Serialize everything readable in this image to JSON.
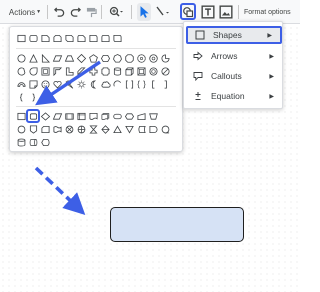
{
  "toolbar": {
    "actions_label": "Actions",
    "format_options_label": "Format options",
    "icons": [
      "undo-icon",
      "redo-icon",
      "paint-format-icon",
      "zoom-icon",
      "select-pointer-icon",
      "line-icon",
      "shape-icon",
      "text-box-icon",
      "image-icon"
    ]
  },
  "insert_menu": {
    "items": [
      {
        "label": "Shapes",
        "icon": "square-outline-icon",
        "selected": true
      },
      {
        "label": "Arrows",
        "icon": "arrow-right-outline-icon",
        "selected": false
      },
      {
        "label": "Callouts",
        "icon": "callout-icon",
        "selected": false
      },
      {
        "label": "Equation",
        "icon": "plus-minus-icon",
        "selected": false
      }
    ]
  },
  "shape_palette": {
    "highlighted_shape": "rounded-rectangle"
  },
  "canvas": {
    "shape_fill": "#d6e2f5"
  },
  "colors": {
    "accent": "#3d5fe6",
    "arrow": "#3d5fe6"
  }
}
